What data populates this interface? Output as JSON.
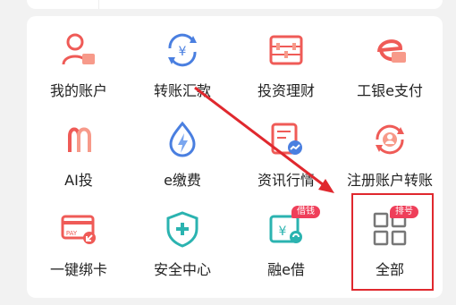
{
  "menu": {
    "items": [
      {
        "label": "我的账户",
        "icon": "user-account-icon"
      },
      {
        "label": "转账汇款",
        "icon": "yen-transfer-icon"
      },
      {
        "label": "投资理财",
        "icon": "abacus-icon"
      },
      {
        "label": "工银e支付",
        "icon": "e-pay-card-icon"
      },
      {
        "label": "AI投",
        "icon": "ai-invest-icon"
      },
      {
        "label": "e缴费",
        "icon": "bolt-payment-icon"
      },
      {
        "label": "资讯行情",
        "icon": "news-chart-icon"
      },
      {
        "label": "注册账户转账",
        "icon": "registered-transfer-icon"
      },
      {
        "label": "一键绑卡",
        "icon": "pay-card-bind-icon"
      },
      {
        "label": "安全中心",
        "icon": "shield-plus-icon"
      },
      {
        "label": "融e借",
        "icon": "loan-yen-icon",
        "badge": "借钱"
      },
      {
        "label": "全部",
        "icon": "grid-all-icon",
        "badge": "排号"
      }
    ]
  },
  "colors": {
    "accent": "#ef5b57",
    "blue": "#4a7fe0",
    "teal": "#2bb3b0",
    "badge": "#ef3f5a",
    "annotation": "#e0282e"
  }
}
